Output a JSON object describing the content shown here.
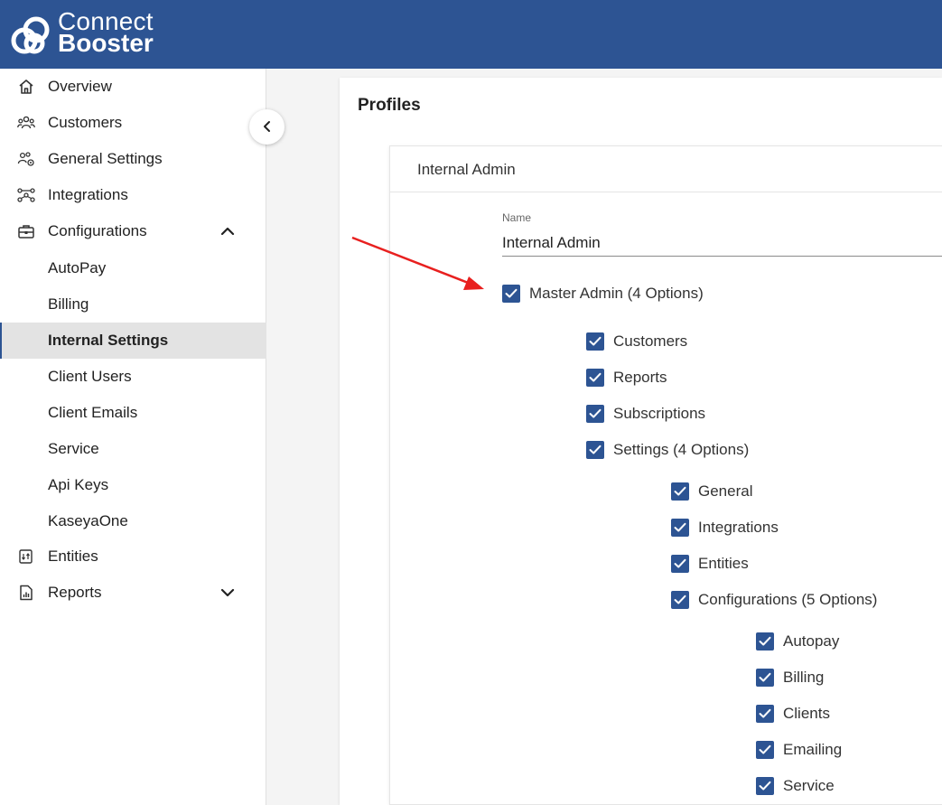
{
  "brand": {
    "line1": "Connect",
    "line2": "Booster",
    "header_color": "#2d5493"
  },
  "sidebar": {
    "items": [
      {
        "label": "Overview",
        "icon": "home-icon"
      },
      {
        "label": "Customers",
        "icon": "users-icon"
      },
      {
        "label": "General Settings",
        "icon": "users-settings-icon"
      },
      {
        "label": "Integrations",
        "icon": "integrations-icon"
      },
      {
        "label": "Configurations",
        "icon": "toolbox-icon",
        "expanded": true
      },
      {
        "label": "AutoPay"
      },
      {
        "label": "Billing"
      },
      {
        "label": "Internal Settings",
        "active": true
      },
      {
        "label": "Client Users"
      },
      {
        "label": "Client Emails"
      },
      {
        "label": "Service"
      },
      {
        "label": "Api Keys"
      },
      {
        "label": "KaseyaOne"
      },
      {
        "label": "Entities",
        "icon": "entities-icon"
      },
      {
        "label": "Reports",
        "icon": "report-icon",
        "expanded": false
      }
    ]
  },
  "main": {
    "title": "Profiles",
    "card": {
      "title": "Internal Admin",
      "name_label": "Name",
      "name_value": "Internal Admin",
      "permissions": [
        {
          "label": "Master Admin (4 Options)",
          "checked": true,
          "level": 0
        },
        {
          "label": "Customers",
          "checked": true,
          "level": 1
        },
        {
          "label": "Reports",
          "checked": true,
          "level": 1
        },
        {
          "label": "Subscriptions",
          "checked": true,
          "level": 1
        },
        {
          "label": "Settings (4 Options)",
          "checked": true,
          "level": 1
        },
        {
          "label": "General",
          "checked": true,
          "level": 2
        },
        {
          "label": "Integrations",
          "checked": true,
          "level": 2
        },
        {
          "label": "Entities",
          "checked": true,
          "level": 2
        },
        {
          "label": "Configurations (5 Options)",
          "checked": true,
          "level": 2
        },
        {
          "label": "Autopay",
          "checked": true,
          "level": 3
        },
        {
          "label": "Billing",
          "checked": true,
          "level": 3
        },
        {
          "label": "Clients",
          "checked": true,
          "level": 3
        },
        {
          "label": "Emailing",
          "checked": true,
          "level": 3
        },
        {
          "label": "Service",
          "checked": true,
          "level": 3
        }
      ]
    }
  },
  "annotation": {
    "type": "arrow",
    "color": "#e8201f"
  }
}
